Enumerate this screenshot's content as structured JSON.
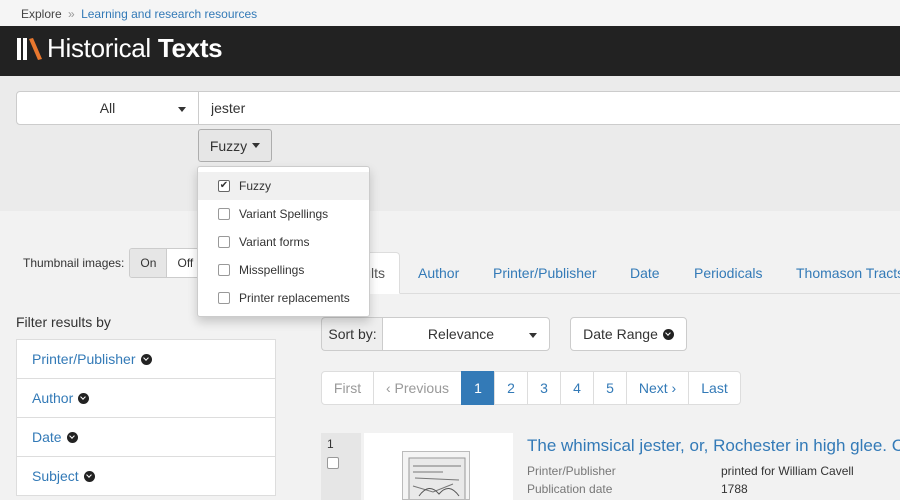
{
  "breadcrumb": {
    "root": "Explore",
    "separator": "»",
    "current": "Learning and research resources"
  },
  "header": {
    "logo_light": "Historical ",
    "logo_bold": "Texts"
  },
  "search": {
    "scope_value": "All",
    "query": "jester",
    "mode_label": "Fuzzy"
  },
  "fuzzy_menu": {
    "items": [
      {
        "label": "Fuzzy",
        "checked": true
      },
      {
        "label": "Variant Spellings",
        "checked": false
      },
      {
        "label": "Variant forms",
        "checked": false
      },
      {
        "label": "Misspellings",
        "checked": false
      },
      {
        "label": "Printer replacements",
        "checked": false
      }
    ]
  },
  "thumbnails": {
    "label": "Thumbnail images:",
    "on": "On",
    "off": "Off"
  },
  "tabs": [
    "Results",
    "Author",
    "Printer/Publisher",
    "Date",
    "Periodicals",
    "Thomason Tracts"
  ],
  "filters": {
    "title": "Filter results by",
    "items": [
      "Printer/Publisher",
      "Author",
      "Date",
      "Subject"
    ]
  },
  "sort": {
    "label": "Sort by:",
    "value": "Relevance",
    "date_range": "Date Range"
  },
  "pagination": [
    "First",
    "‹ Previous",
    "1",
    "2",
    "3",
    "4",
    "5",
    "Next ›",
    "Last"
  ],
  "current_page": 1,
  "results": [
    {
      "number": "1",
      "title": "The whimsical jester, or, Rochester in high glee. Containing",
      "meta": [
        {
          "key": "Printer/Publisher",
          "value": "printed for William Cavell"
        },
        {
          "key": "Publication date",
          "value": "1788"
        }
      ]
    }
  ],
  "colors": {
    "link": "#337ab7",
    "header_bg": "#222222",
    "logo_accent": "#e8772e",
    "active_page": "#337ab7"
  }
}
